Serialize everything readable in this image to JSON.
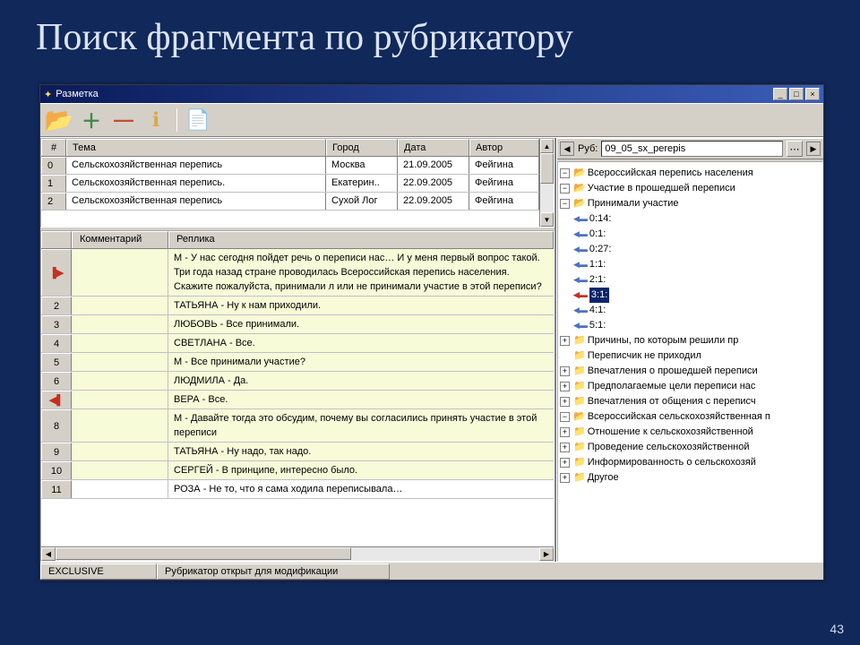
{
  "slide": {
    "title": "Поиск фрагмента по рубрикатору",
    "number": "43"
  },
  "window": {
    "title": "Разметка"
  },
  "grid": {
    "columns": {
      "num": "#",
      "theme": "Тема",
      "city": "Город",
      "date": "Дата",
      "author": "Автор"
    },
    "rows": [
      {
        "num": "0",
        "theme": "Сельскохозяйственная перепись",
        "city": "Москва",
        "date": "21.09.2005",
        "author": "Фейгина"
      },
      {
        "num": "1",
        "theme": "Сельскохозяйственная перепись.",
        "city": "Екатерин..",
        "date": "22.09.2005",
        "author": "Фейгина"
      },
      {
        "num": "2",
        "theme": "Сельскохозяйственная перепись",
        "city": "Сухой Лог",
        "date": "22.09.2005",
        "author": "Фейгина"
      }
    ]
  },
  "transcript": {
    "columns": {
      "comment": "Комментарий",
      "reply": "Реплика"
    },
    "rows": [
      {
        "num": "",
        "mark": "right",
        "reply": "М - У нас сегодня пойдет речь о переписи нас… И у меня первый вопрос такой. Три года назад стране проводилась Всероссийская перепись населения. Скажите пожалуйста, принимали л или не принимали участие в этой переписи?",
        "cls": ""
      },
      {
        "num": "2",
        "reply": "ТАТЬЯНА - Ну к нам приходили.",
        "cls": ""
      },
      {
        "num": "3",
        "reply": "ЛЮБОВЬ - Все принимали.",
        "cls": ""
      },
      {
        "num": "4",
        "reply": "СВЕТЛАНА - Все.",
        "cls": ""
      },
      {
        "num": "5",
        "reply": "М - Все принимали участие?",
        "cls": ""
      },
      {
        "num": "6",
        "reply": "ЛЮДМИЛА - Да.",
        "cls": ""
      },
      {
        "num": "",
        "mark": "left",
        "reply": "ВЕРА - Все.",
        "cls": ""
      },
      {
        "num": "8",
        "reply": "М - Давайте тогда это обсудим, почему вы согласились принять участие в этой переписи",
        "cls": ""
      },
      {
        "num": "9",
        "reply": "ТАТЬЯНА - Ну надо, так надо.",
        "cls": ""
      },
      {
        "num": "10",
        "reply": "СЕРГЕЙ - В принципе, интересно было.",
        "cls": ""
      },
      {
        "num": "11",
        "reply": "РОЗА - Не то, что я сама ходила переписывала…",
        "cls": "white"
      }
    ]
  },
  "rub": {
    "label": "Руб:",
    "value": "09_05_sx_perepis",
    "tree": {
      "root1": "Всероссийская перепись населения",
      "n1": "Участие в прошедшей переписи",
      "n2": "Принимали участие",
      "leaves": [
        "0:14:",
        "0:1:",
        "0:27:",
        "1:1:",
        "2:1:",
        "3:1:",
        "4:1:",
        "5:1:"
      ],
      "n3": "Причины, по которым решили пр",
      "n4": "Переписчик не приходил",
      "n5": "Впечатления о прошедшей переписи",
      "n6": "Предполагаемые цели переписи нас",
      "n7": "Впечатления от общения с переписч",
      "root2": "Всероссийская сельскохозяйственная п",
      "m1": "Отношение к сельскохозяйственной",
      "m2": "Проведение сельскохозяйственной",
      "m3": "Информированность о сельскохозяй",
      "root3": "Другое"
    }
  },
  "status": {
    "exclusive": "EXCLUSIVE",
    "info": "Рубрикатор открыт для модификации"
  }
}
